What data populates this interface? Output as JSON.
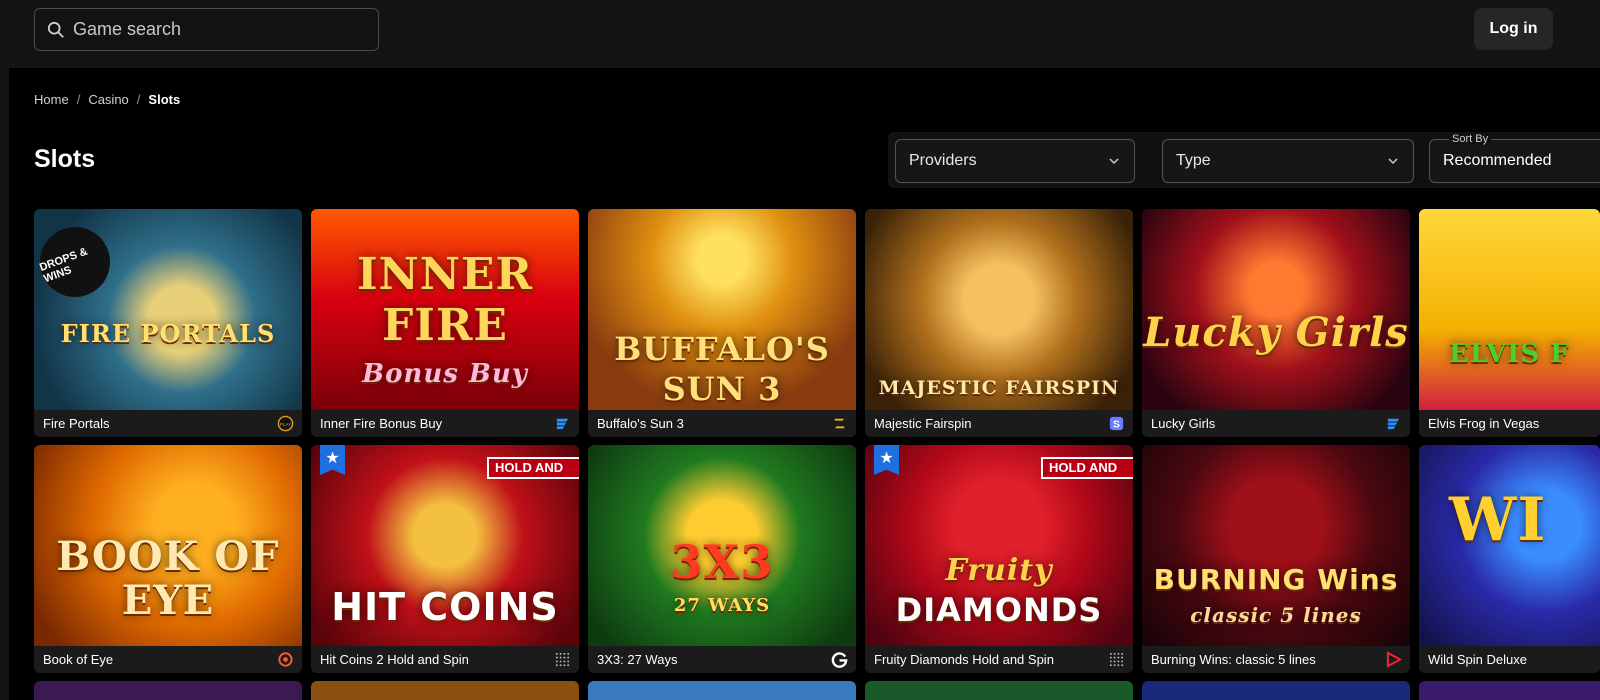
{
  "search": {
    "placeholder": "Game search"
  },
  "header": {
    "login_label": "Log in"
  },
  "breadcrumb": {
    "home": "Home",
    "casino": "Casino",
    "current": "Slots",
    "sep": "/"
  },
  "page": {
    "title": "Slots"
  },
  "filters": {
    "providers_label": "Providers",
    "type_label": "Type",
    "sort_caption": "Sort By",
    "sort_value": "Recommended"
  },
  "games": [
    {
      "name": "Fire Portals",
      "art_text": "FIRE PORTALS",
      "badge": "DROPS & WINS",
      "provider_icon": "pragmatic-play-icon"
    },
    {
      "name": "Inner Fire Bonus Buy",
      "art_text": "INNER FIRE",
      "art_sub": "Bonus Buy",
      "provider_icon": "provider-stripes-icon"
    },
    {
      "name": "Buffalo's Sun 3",
      "art_text": "BUFFALO'S SUN 3",
      "provider_icon": "provider-z-icon"
    },
    {
      "name": "Majestic Fairspin",
      "art_text": "MAJESTIC FAIRSPIN",
      "provider_icon": "provider-s-icon"
    },
    {
      "name": "Lucky Girls",
      "art_text": "Lucky Girls",
      "provider_icon": "provider-stripes-icon"
    },
    {
      "name": "Elvis Frog in Vegas",
      "art_text": "ELVIS F",
      "provider_icon": "provider-icon"
    },
    {
      "name": "Book of Eye",
      "art_text": "BOOK OF EYE",
      "provider_icon": "provider-target-icon"
    },
    {
      "name": "Hit Coins 2 Hold and Spin",
      "art_text": "HIT COINS",
      "badge": "HOLD AND",
      "provider_icon": "provider-dots-icon"
    },
    {
      "name": "3X3: 27 Ways",
      "art_text": "3X3",
      "art_sub": "27 WAYS",
      "provider_icon": "provider-g-icon"
    },
    {
      "name": "Fruity Diamonds Hold and Spin",
      "art_text": "DIAMONDS",
      "art_sub": "Fruity",
      "badge": "HOLD AND",
      "provider_icon": "provider-dots-icon"
    },
    {
      "name": "Burning Wins: classic 5 lines",
      "art_text": "BURNING Wins",
      "art_sub": "classic 5 lines",
      "provider_icon": "provider-play-icon"
    },
    {
      "name": "Wild Spin Deluxe",
      "art_text": "WI",
      "provider_icon": "provider-icon"
    }
  ],
  "colors": {
    "accent_blue": "#1e6fe0",
    "badge_red": "#b80012"
  }
}
